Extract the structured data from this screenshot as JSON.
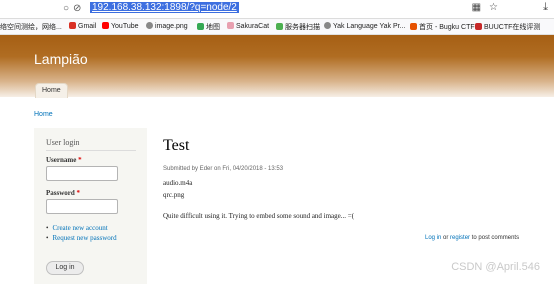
{
  "browser": {
    "url": "192.168.38.132:1898/?q=node/2",
    "bookmarks": [
      "络空间测绘，网络...",
      "Gmail",
      "YouTube",
      "image.png",
      "地图",
      "SakuraCat",
      "服务器扫描",
      "Yak Language Yak Pr...",
      "首页 - Bugku CTF",
      "BUUCTF在线评测"
    ]
  },
  "site": {
    "name": "Lampião",
    "tab_home": "Home"
  },
  "breadcrumb": "Home",
  "sidebar": {
    "title": "User login",
    "username_label": "Username",
    "password_label": "Password",
    "required": "*",
    "create_account": "Create new account",
    "request_password": "Request new password",
    "login_button": "Log in"
  },
  "node": {
    "title": "Test",
    "submitted": "Submitted by Eder on Fri, 04/20/2018 - 13:53",
    "files": [
      "audio.m4a",
      "qrc.png"
    ],
    "body": "Quite difficult using it. Trying to embed some sound and image... =(",
    "login_link": "Log in",
    "or": "or",
    "register_link": "register",
    "post_comments": "to post comments"
  },
  "watermark": "CSDN @April.546"
}
